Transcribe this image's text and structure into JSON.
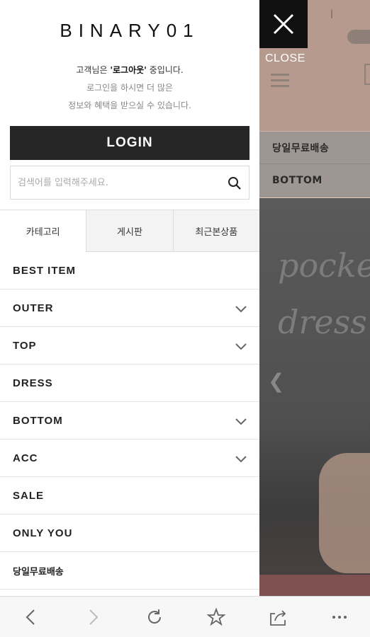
{
  "background": {
    "menu_rows": [
      "당일무료배송",
      "BOTTOM"
    ],
    "script_text": "pocket dress"
  },
  "close": {
    "label": "CLOSE"
  },
  "drawer": {
    "logo": "BINARY01",
    "greeting_prefix": "고객님은 ",
    "greeting_status": "'로그아웃'",
    "greeting_suffix": " 중입니다.",
    "info_line1": "로그인을 하시면 더 많은",
    "info_line2": "정보와 혜택을 받으실 수 있습니다.",
    "login_label": "LOGIN",
    "search": {
      "placeholder": "검색어를 입력해주세요."
    },
    "tabs": [
      {
        "label": "카테고리",
        "active": true
      },
      {
        "label": "게시판",
        "active": false
      },
      {
        "label": "최근본상품",
        "active": false
      }
    ],
    "menu": [
      {
        "label": "BEST ITEM",
        "expandable": false
      },
      {
        "label": "OUTER",
        "expandable": true
      },
      {
        "label": "TOP",
        "expandable": true
      },
      {
        "label": "DRESS",
        "expandable": false
      },
      {
        "label": "BOTTOM",
        "expandable": true
      },
      {
        "label": "ACC",
        "expandable": true
      },
      {
        "label": "SALE",
        "expandable": false
      },
      {
        "label": "ONLY YOU",
        "expandable": false
      },
      {
        "label": "당일무료배송",
        "expandable": false
      }
    ]
  },
  "browser_bar": {
    "buttons": [
      "back-icon",
      "forward-icon",
      "refresh-icon",
      "star-icon",
      "share-icon",
      "more-icon"
    ]
  }
}
